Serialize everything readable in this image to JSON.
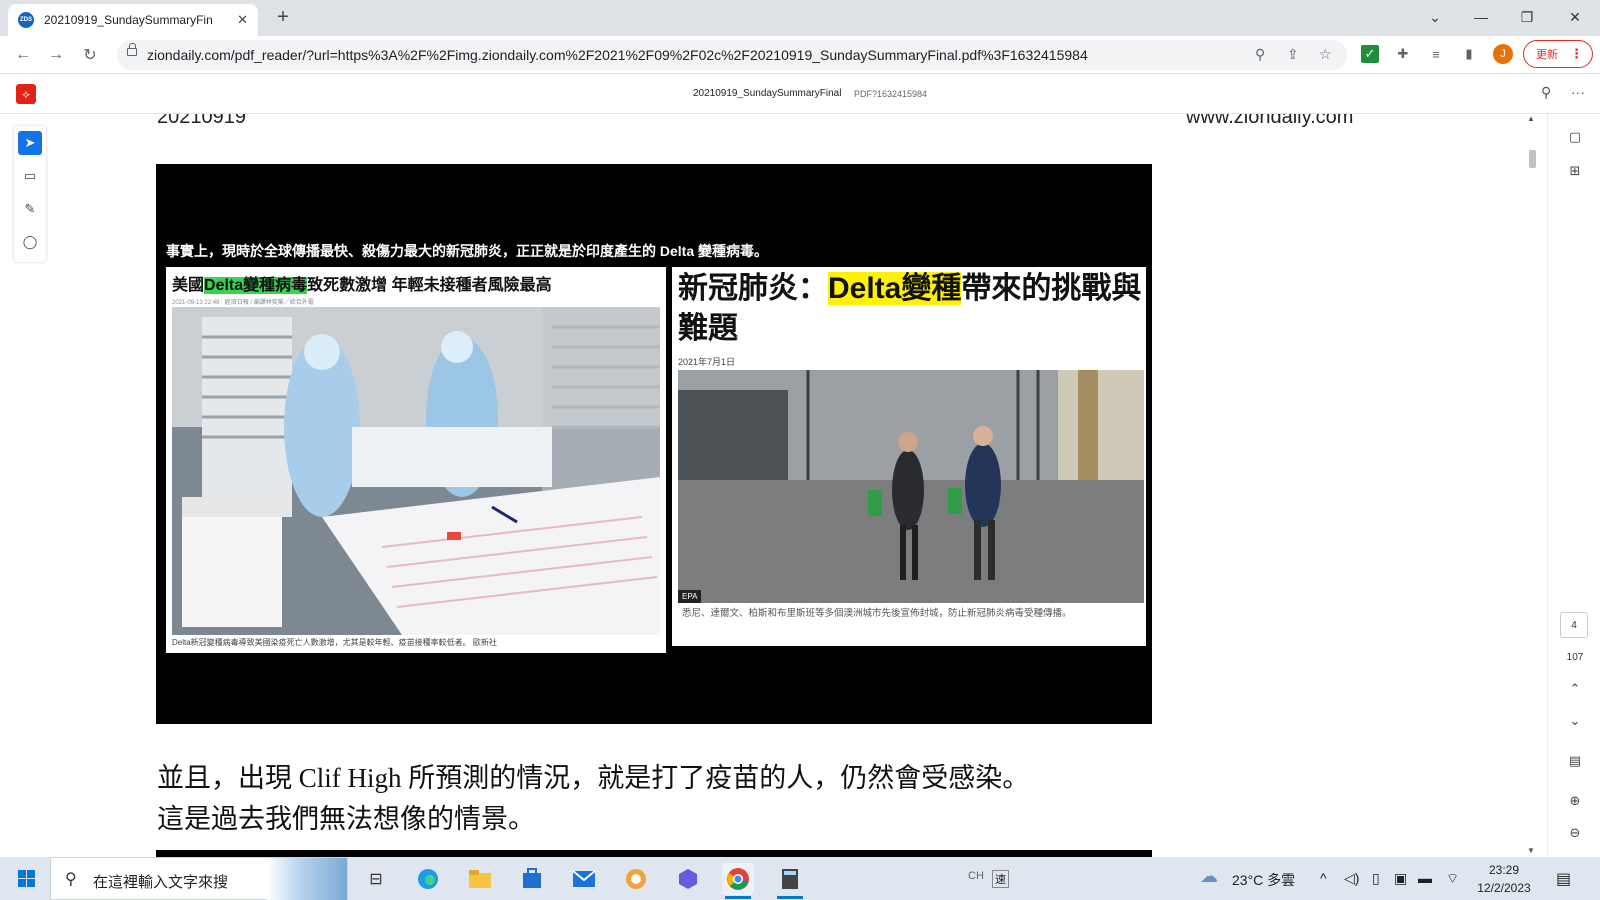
{
  "browser": {
    "tab_title": "20210919_SundaySummaryFin",
    "favicon_label": "ZDS",
    "tab_close": "✕",
    "new_tab": "+",
    "url": "ziondaily.com/pdf_reader/?url=https%3A%2F%2Fimg.ziondaily.com%2F2021%2F09%2F02c%2F20210919_SundaySummaryFinal.pdf%3F1632415984",
    "avatar_letter": "J",
    "update_button": "更新"
  },
  "reader": {
    "doc_title": "20210919_SundaySummaryFinal",
    "doc_meta": "PDF?1632415984"
  },
  "page": {
    "date_header": "20210919",
    "site_header": "www.ziondaily.com",
    "slide_caption": "事實上，現時於全球傳播最快、殺傷力最大的新冠肺炎，正正就是於印度產生的 Delta 變種病毒。",
    "left_article": {
      "head_pre": "美國",
      "head_highlight": "Delta變種病毒",
      "head_post": "致死數激增 年輕未接種者風險最高",
      "meta": "2021-09-13 22:49 · 經濟日報 / 編譯林奕榮／綜合外電",
      "caption": "Delta新冠變種病毒導致美國染疫死亡人數激增，尤其是較年輕、疫苗接種率較低者。 歐新社"
    },
    "right_article": {
      "head_pre": "新冠肺炎：",
      "head_highlight": "Delta變種",
      "head_post": "帶來的挑戰與難題",
      "date": "2021年7月1日",
      "photo_credit": "EPA",
      "caption": "悉尼、達爾文、柏斯和布里斯班等多個澳洲城市先後宣佈封城，防止新冠肺炎病毒受種傳播。"
    },
    "body_line1": "並且，出現 Clif High 所預測的情況，就是打了疫苗的人，仍然會受感染。",
    "body_line2": "這是過去我們無法想像的情景。"
  },
  "right_panel": {
    "current_page": "4",
    "total_pages": "107"
  },
  "taskbar": {
    "search_placeholder": "在這裡輸入文字來搜",
    "weather": "23°C 多雲",
    "time": "23:29",
    "date": "12/2/2023",
    "ime": "CH",
    "ime2": "速"
  }
}
